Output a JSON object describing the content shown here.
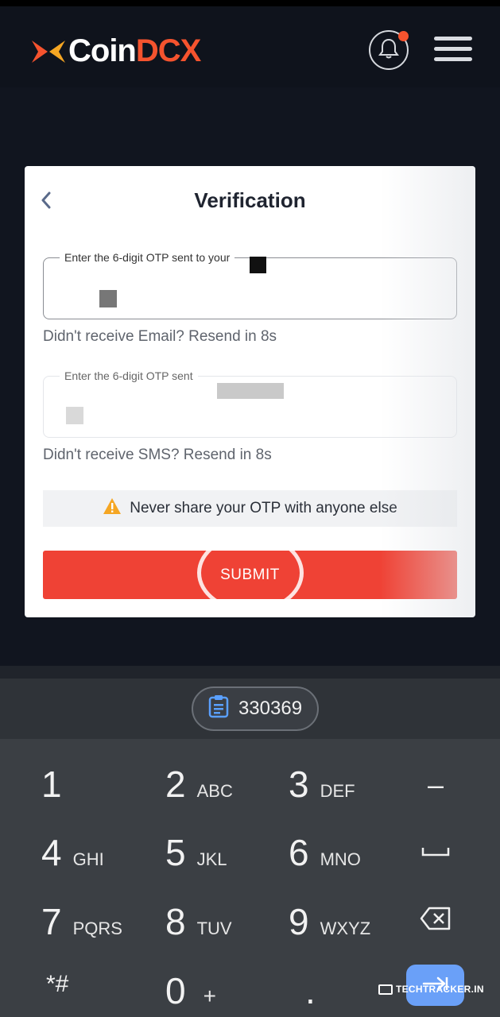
{
  "header": {
    "logo_text_coin": "Coin",
    "logo_text_dcx": "DCX",
    "brand_color": "#f5532e",
    "notification_icon": "bell-icon",
    "menu_icon": "hamburger-menu-icon"
  },
  "verification": {
    "title": "Verification",
    "back_icon": "chevron-left-icon",
    "email_field": {
      "label": "Enter the 6-digit OTP sent to your",
      "value": ""
    },
    "email_helper": "Didn't receive Email? Resend in 8s",
    "sms_field": {
      "label": "Enter the 6-digit OTP sent",
      "value": ""
    },
    "sms_helper": "Didn't receive SMS? Resend in 8s",
    "warning_icon": "warning-triangle-icon",
    "warning_text": "Never share your OTP with anyone else",
    "submit_label": "SUBMIT",
    "submit_color": "#ef4235"
  },
  "keyboard": {
    "clipboard_icon": "clipboard-icon",
    "suggestion": "330369",
    "keys": [
      {
        "num": "1",
        "sub": ""
      },
      {
        "num": "2",
        "sub": "ABC"
      },
      {
        "num": "3",
        "sub": "DEF"
      },
      {
        "num": "4",
        "sub": "GHI"
      },
      {
        "num": "5",
        "sub": "JKL"
      },
      {
        "num": "6",
        "sub": "MNO"
      },
      {
        "num": "7",
        "sub": "PQRS"
      },
      {
        "num": "8",
        "sub": "TUV"
      },
      {
        "num": "9",
        "sub": "WXYZ"
      },
      {
        "num": "*#",
        "sub": ""
      },
      {
        "num": "0",
        "sub": "+"
      },
      {
        "num": ".",
        "sub": ""
      }
    ],
    "side_keys": {
      "minus": "–",
      "space_icon": "space-icon",
      "backspace_icon": "backspace-icon",
      "enter_icon": "enter-arrow-icon"
    }
  },
  "watermark": "TECHTRACKER.IN"
}
